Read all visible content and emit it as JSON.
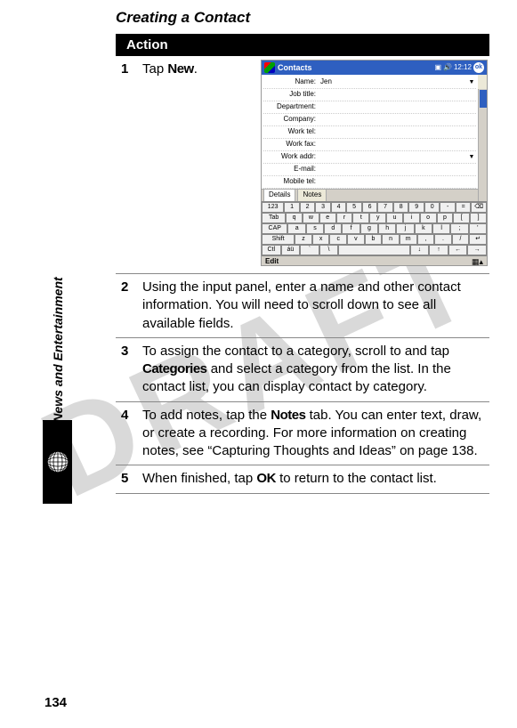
{
  "watermark": "DRAFT",
  "page_title": "Creating a Contact",
  "side_label": "News and Entertainment",
  "page_number": "134",
  "action_header": "Action",
  "steps": {
    "s1": {
      "num": "1",
      "pre": "Tap ",
      "kw": "New",
      "post": "."
    },
    "s2": {
      "num": "2",
      "text": "Using the input panel, enter a name and other contact information. You will need to scroll down to see all available fields."
    },
    "s3": {
      "num": "3",
      "pre": "To assign the contact to a category, scroll to and tap ",
      "kw": "Categories",
      "post": " and select a category from the list. In the contact list, you can display contact by category."
    },
    "s4": {
      "num": "4",
      "pre": "To add notes, tap the ",
      "kw": "Notes",
      "post": " tab. You can enter text, draw, or create a recording. For more information on creating notes, see “Capturing Thoughts and Ideas” on page 138."
    },
    "s5": {
      "num": "5",
      "pre": "When finished, tap ",
      "kw": "OK",
      "post": " to return to the contact list."
    }
  },
  "device": {
    "titlebar": {
      "title": "Contacts",
      "time": "12:12",
      "ok": "ok"
    },
    "form_labels": {
      "name": "Name:",
      "jobtitle": "Job title:",
      "department": "Department:",
      "company": "Company:",
      "worktel": "Work tel:",
      "workfax": "Work fax:",
      "workaddr": "Work addr:",
      "email": "E-mail:",
      "mobile": "Mobile tel:"
    },
    "name_value": "Jen",
    "tabs": {
      "details": "Details",
      "notes": "Notes"
    },
    "bottom": {
      "edit": "Edit"
    },
    "kb": {
      "r1": [
        "123",
        "1",
        "2",
        "3",
        "4",
        "5",
        "6",
        "7",
        "8",
        "9",
        "0",
        "-",
        "=",
        "⌫"
      ],
      "r2": [
        "Tab",
        "q",
        "w",
        "e",
        "r",
        "t",
        "y",
        "u",
        "i",
        "o",
        "p",
        "[",
        "]"
      ],
      "r3": [
        "CAP",
        "a",
        "s",
        "d",
        "f",
        "g",
        "h",
        "j",
        "k",
        "l",
        ";",
        "'"
      ],
      "r4": [
        "Shift",
        "z",
        "x",
        "c",
        "v",
        "b",
        "n",
        "m",
        ",",
        ".",
        "/",
        "↵"
      ],
      "r5": [
        "Ctl",
        "áü",
        "`",
        "\\",
        " ",
        " ",
        " ",
        " ",
        "↓",
        "↑",
        "←",
        "→"
      ]
    }
  }
}
